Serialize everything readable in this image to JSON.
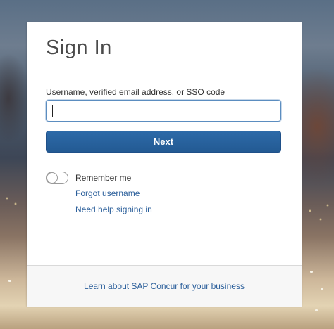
{
  "signin": {
    "title": "Sign In",
    "username_label": "Username, verified email address, or SSO code",
    "username_value": "",
    "next_label": "Next",
    "remember_label": "Remember me",
    "remember_checked": false,
    "forgot_username": "Forgot username",
    "need_help": "Need help signing in"
  },
  "footer": {
    "learn_link": "Learn about SAP Concur for your business"
  },
  "colors": {
    "primary": "#2a64a0",
    "link": "#2a5e9a",
    "focus_border": "#5b8dc0"
  }
}
